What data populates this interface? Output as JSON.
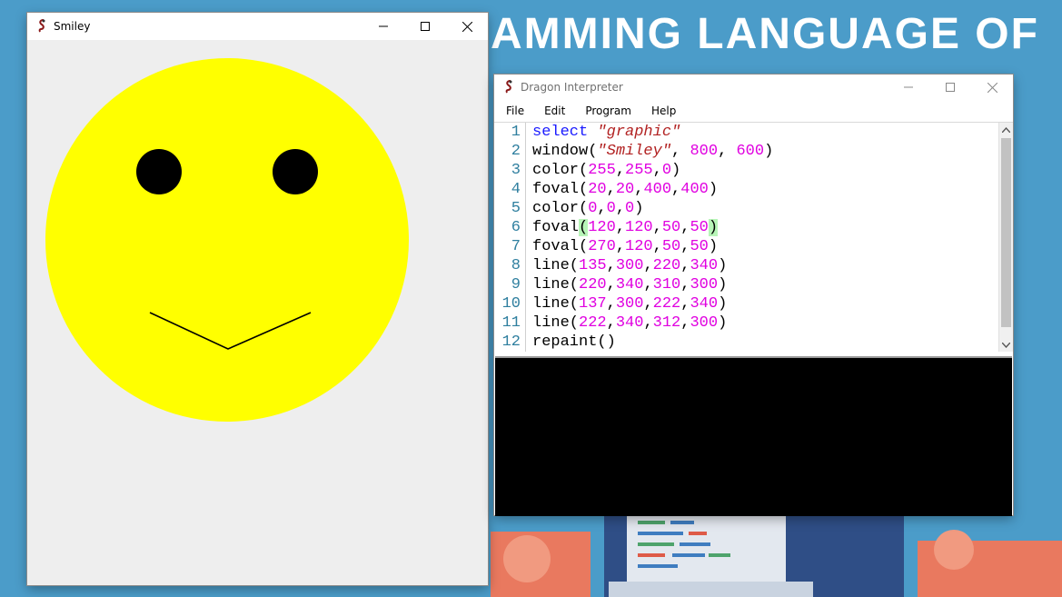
{
  "background": {
    "banner_text": "AMMING LANGUAGE OF"
  },
  "smiley_window": {
    "title": "Smiley",
    "face_color": "#ffff00",
    "feature_color": "#000000"
  },
  "interpreter_window": {
    "title": "Dragon Interpreter",
    "menu": [
      "File",
      "Edit",
      "Program",
      "Help"
    ],
    "line_numbers": [
      "1",
      "2",
      "3",
      "4",
      "5",
      "6",
      "7",
      "8",
      "9",
      "10",
      "11",
      "12"
    ],
    "code": {
      "l1_kw": "select",
      "l1_str": "\"graphic\"",
      "l2_fn": "window(",
      "l2_str": "\"Smiley\"",
      "l2_sep1": ", ",
      "l2_n1": "800",
      "l2_sep2": ", ",
      "l2_n2": "600",
      "l2_end": ")",
      "l3_fn": "color(",
      "l3_args": [
        "255",
        "255",
        "0"
      ],
      "l4_fn": "foval(",
      "l4_args": [
        "20",
        "20",
        "400",
        "400"
      ],
      "l5_fn": "color(",
      "l5_args": [
        "0",
        "0",
        "0"
      ],
      "l6_fn": "foval",
      "l6_open": "(",
      "l6_args": [
        "120",
        "120",
        "50",
        "50"
      ],
      "l6_close": ")",
      "l7_fn": "foval(",
      "l7_args": [
        "270",
        "120",
        "50",
        "50"
      ],
      "l8_fn": "line(",
      "l8_args": [
        "135",
        "300",
        "220",
        "340"
      ],
      "l9_fn": "line(",
      "l9_args": [
        "220",
        "340",
        "310",
        "300"
      ],
      "l10_fn": "line(",
      "l10_args": [
        "137",
        "300",
        "222",
        "340"
      ],
      "l11_fn": "line(",
      "l11_args": [
        "222",
        "340",
        "312",
        "300"
      ],
      "l12_fn": "repaint()"
    }
  }
}
